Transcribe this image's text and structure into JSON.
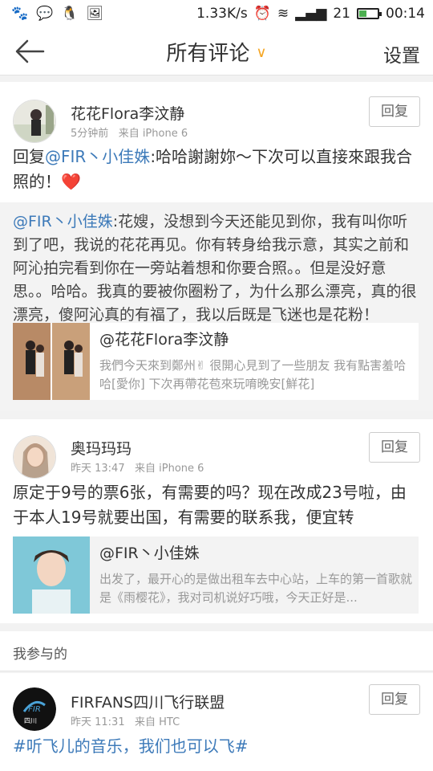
{
  "status_bar": {
    "speed": "1.33K/s",
    "signal": "21",
    "time": "00:14"
  },
  "header": {
    "title": "所有评论",
    "settings_label": "设置"
  },
  "comments": [
    {
      "user": "花花Flora李汶静",
      "time": "5分钟前",
      "source": "来自 iPhone 6",
      "reply_label": "回复",
      "text_prefix": "回复",
      "text_mention": "@FIR丶小佳姝",
      "text_body": ":哈哈謝謝妳～下次可以直接來跟我合照的！",
      "heart": "❤️",
      "quote_mention": "@FIR丶小佳姝",
      "quote_body": ":花嫂，没想到今天还能见到你，我有叫你听到了吧，我说的花花再见。你有转身给我示意，其实之前和阿沁拍完看到你在一旁站着想和你要合照。。但是没好意思。。哈哈。我真的要被你圈粉了，为什么那么漂亮，真的很漂亮，傻阿沁真的有福了，我以后既是飞迷也是花粉！",
      "embed_title": "@花花Flora李汶静",
      "embed_desc": "我們今天來到鄭州✌ 很開心見到了一些朋友 我有點害羞哈哈[愛你] 下次再帶花苞來玩唷晚安[鮮花]"
    },
    {
      "user": "奥玛玛玛",
      "time": "昨天 13:47",
      "source": "来自 iPhone 6",
      "reply_label": "回复",
      "text_body": "原定于9号的票6张，有需要的吗？现在改成23号啦，由于本人19号就要出国，有需要的联系我，便宜转",
      "embed_title": "@FIR丶小佳姝",
      "embed_desc": "出发了，最开心的是做出租车去中心站，上车的第一首歌就是《雨樱花》，我对司机说好巧哦，今天正好是..."
    }
  ],
  "section": {
    "label": "我参与的"
  },
  "participated": {
    "user": "FIRFANS四川飞行联盟",
    "time": "昨天 11:31",
    "source": "来自 HTC",
    "reply_label": "回复",
    "text": "#听飞儿的音乐，我们也可以飞#",
    "avatar_caption": "四川"
  },
  "colors": {
    "accent": "#f5a623",
    "link": "#3d7ab9",
    "heart": "#e0245e",
    "battery": "#4caf50"
  }
}
